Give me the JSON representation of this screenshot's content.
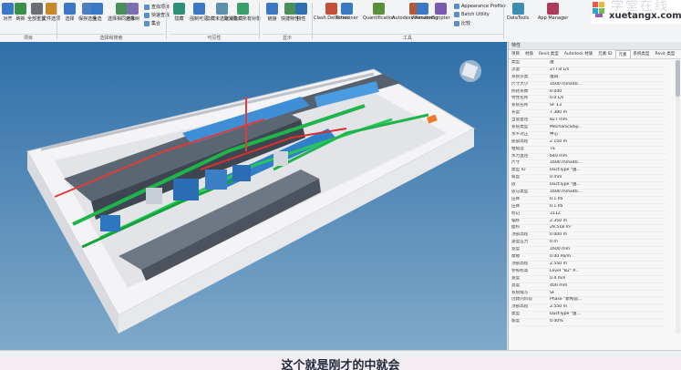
{
  "ribbon": {
    "buttons": [
      {
        "label": "对齐",
        "color": "#3a78c4"
      },
      {
        "label": "刷新",
        "color": "#3a8f4a"
      },
      {
        "label": "全部重置",
        "color": "#6a6f76"
      },
      {
        "label": "文件选项",
        "color": "#c48a2a"
      },
      {
        "label": "选择",
        "color": "#3a78c4"
      },
      {
        "label": "保存选择",
        "color": "#4b7fbf"
      },
      {
        "label": "全选",
        "color": "#3a78c4"
      },
      {
        "label": "选择相同对象",
        "color": "#4a8f5a"
      },
      {
        "label": "选择树",
        "color": "#7a6fb0"
      },
      {
        "label": "隐藏",
        "color": "#2f8f7a"
      },
      {
        "label": "强制可见",
        "color": "#3a78c4"
      },
      {
        "label": "隐藏未选定对象",
        "color": "#5a8fb0"
      },
      {
        "label": "取消隐藏所有对象",
        "color": "#3a9f6a"
      },
      {
        "label": "链接",
        "color": "#3a78c4"
      },
      {
        "label": "快捷特性",
        "color": "#4a8f5a"
      },
      {
        "label": "特性",
        "color": "#2f6fb0"
      },
      {
        "label": "Clash Detective",
        "color": "#c4503a"
      },
      {
        "label": "TimeLiner",
        "color": "#3a78c4"
      },
      {
        "label": "Quantification",
        "color": "#5a8f3a"
      },
      {
        "label": "Autodesk Rendering",
        "color": "#b05a3a"
      },
      {
        "label": "Animator",
        "color": "#3a78c4"
      },
      {
        "label": "Scripter",
        "color": "#7a5ab0"
      },
      {
        "label": "DataTools",
        "color": "#3a8fb0"
      },
      {
        "label": "App Manager",
        "color": "#b03a5a"
      }
    ],
    "small_items": [
      "查找项目",
      "快速查找",
      "集合",
      "Appearance Profiler",
      "Batch Utility",
      "比较"
    ],
    "groups": [
      "项目",
      "选择和搜索",
      "可见性",
      "显示",
      "工具"
    ]
  },
  "logo": {
    "text_top": "学堂在线",
    "text_bottom": "xuetangx.com"
  },
  "panel": {
    "title": "特性",
    "tabs": [
      "项目",
      "材质",
      "Revit 类型",
      "Autodesk 材质",
      "元素 ID",
      "元素",
      "系统类型",
      "Revit 类型"
    ],
    "active_tab": "元素",
    "rows": [
      [
        "类型",
        "送"
      ],
      [
        "流量",
        "277.8 L/s"
      ],
      [
        "系统分类",
        "送风"
      ],
      [
        "尺寸大小",
        "1600 mmx40..."
      ],
      [
        "损耗系数",
        "0.040"
      ],
      [
        "特性名称",
        "0.0 L/s"
      ],
      [
        "系统名称",
        "SF 13"
      ],
      [
        "长度",
        "7.380 m"
      ],
      [
        "当量直径",
        "827 mm"
      ],
      [
        "系统类型",
        "MechanicalSy..."
      ],
      [
        "水平对正",
        "中心"
      ],
      [
        "底部高程",
        "2.150 m"
      ],
      [
        "粗糙度",
        "TS"
      ],
      [
        "水力直径",
        "640 mm"
      ],
      [
        "尺寸",
        "1600 mmx40..."
      ],
      [
        "类型 ID",
        "DuctType \"送..."
      ],
      [
        "坡度",
        "0 mm"
      ],
      [
        "族",
        "DuctType \"送..."
      ],
      [
        "族与类型",
        "1600 mmx40..."
      ],
      [
        "压降",
        "0.1 Pa"
      ],
      [
        "压降",
        "0.1 Pa"
      ],
      [
        "标记",
        "3112"
      ],
      [
        "偏移",
        "2.350 m"
      ],
      [
        "面积",
        "29.518 m²"
      ],
      [
        "顶部高程",
        "0.000 m"
      ],
      [
        "速度压力",
        "0 m"
      ],
      [
        "宽度",
        "1600 mm"
      ],
      [
        "摩擦",
        "0.00 Pa/m"
      ],
      [
        "顶部高程",
        "2.550 m"
      ],
      [
        "参照标高",
        "Level \"B2\" P..."
      ],
      [
        "速度",
        "0.4 m/s"
      ],
      [
        "高度",
        "400 mm"
      ],
      [
        "系统缩写",
        "SF"
      ],
      [
        "创建的阶段",
        "Phase \"新构造..."
      ],
      [
        "顶部高程",
        "2.550 m"
      ],
      [
        "类型",
        "DuctType \"送..."
      ],
      [
        "坡度",
        "0.00%"
      ]
    ]
  },
  "status": {
    "left": "",
    "right": ""
  },
  "subtitle": "这个就是刚才的中就会"
}
